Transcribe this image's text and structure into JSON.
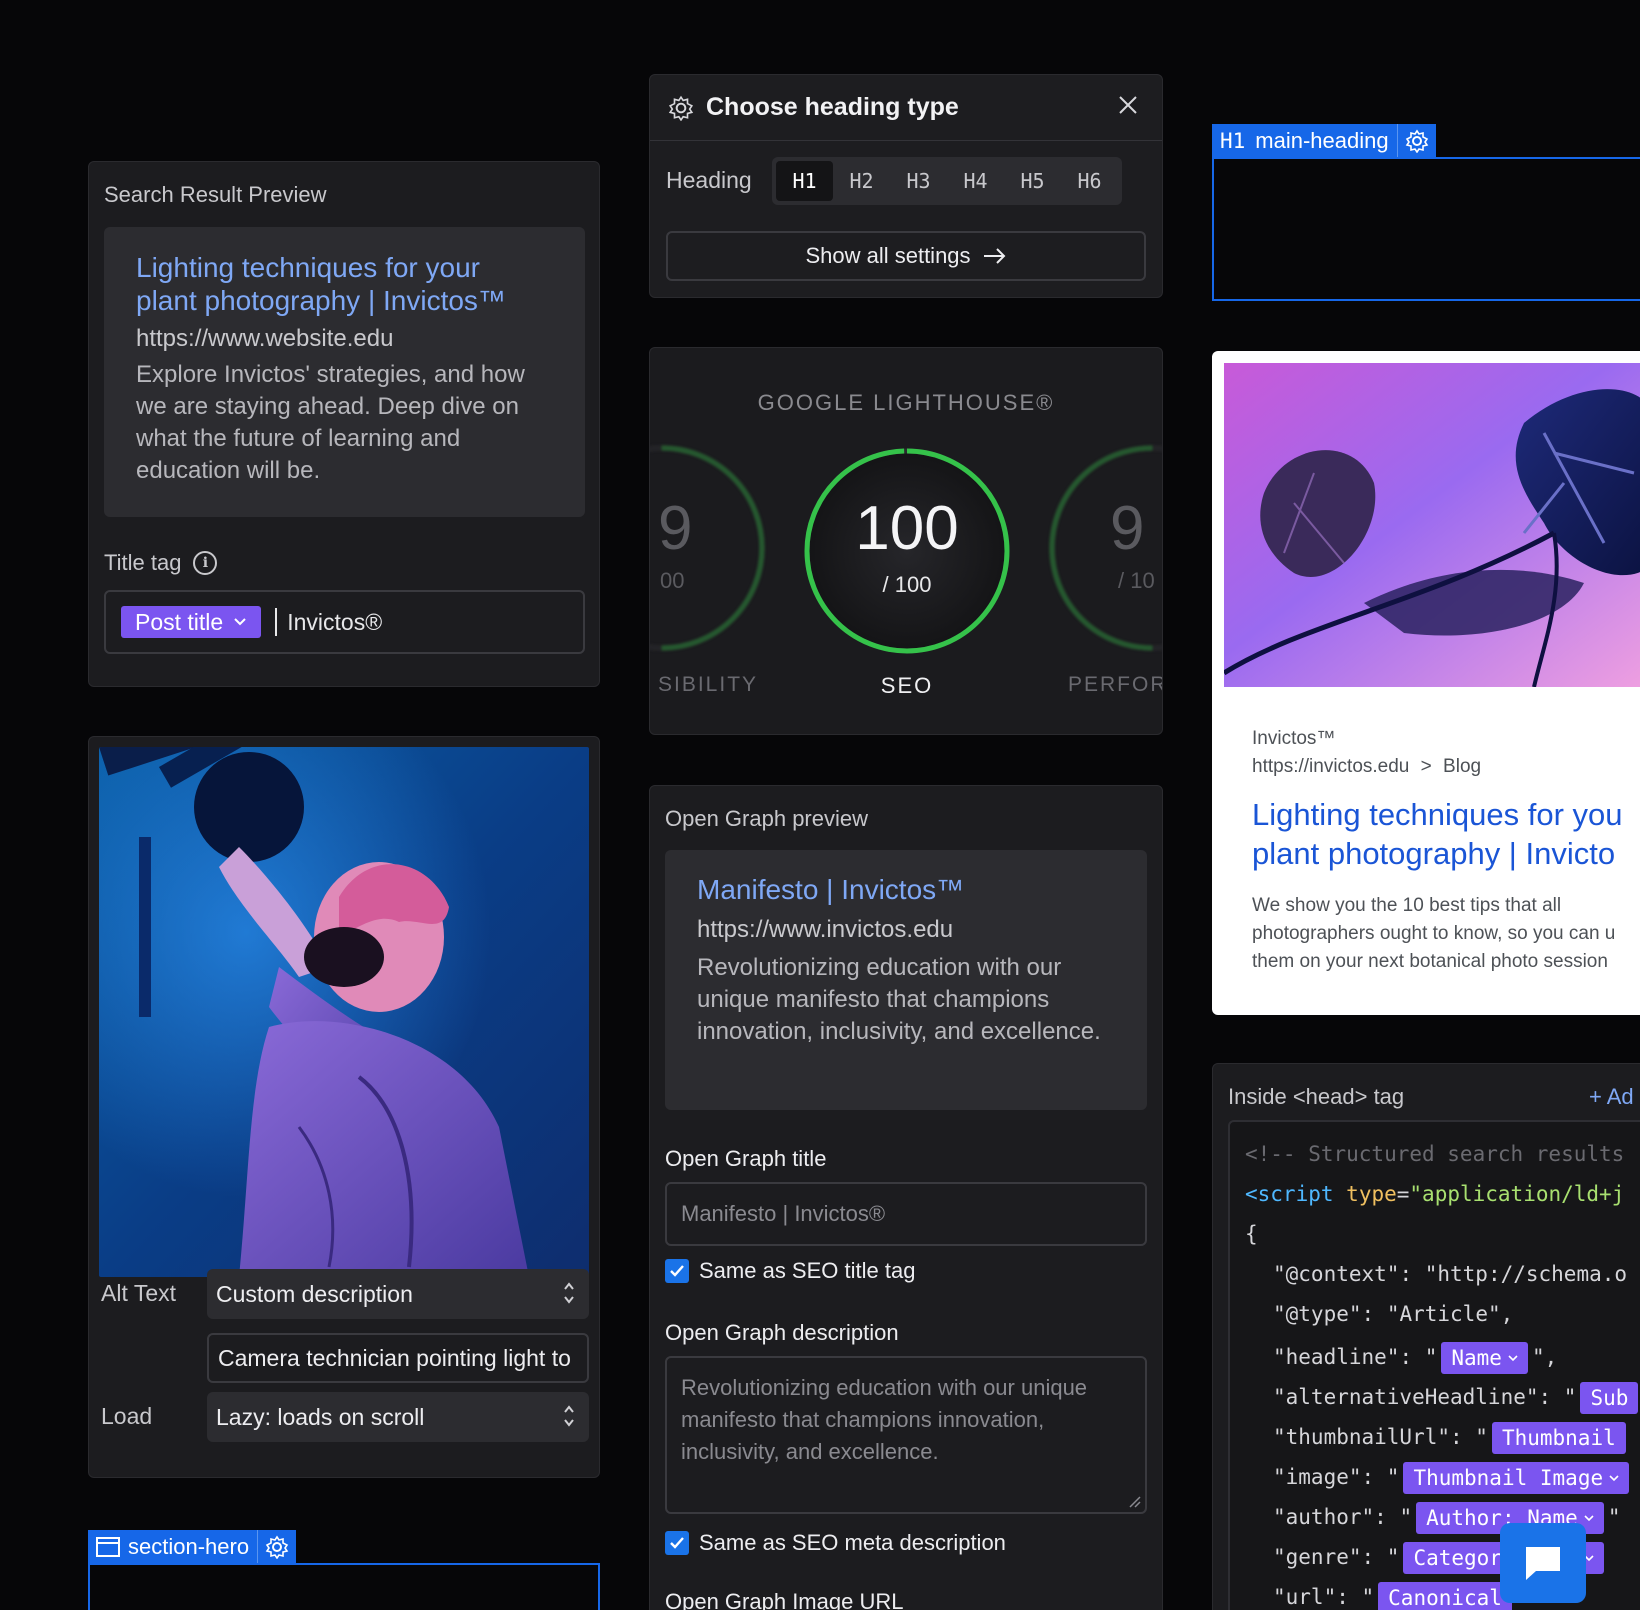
{
  "search_preview": {
    "header": "Search Result Preview",
    "title_line1": "Lighting techniques for your",
    "title_line2": "plant photography | Invictos™",
    "url": "https://www.website.edu",
    "description": "Explore Invictos' strategies, and how we are staying ahead. Deep dive on what the future of learning and education will be.",
    "title_tag_label": "Title tag",
    "title_chip": "Post title",
    "title_suffix": "Invictos®"
  },
  "image_panel": {
    "alt_label": "Alt Text",
    "alt_mode": "Custom description",
    "alt_value": "Camera technician pointing light to",
    "load_label": "Load",
    "load_value": "Lazy: loads on scroll"
  },
  "section_hero": {
    "label": "section-hero"
  },
  "heading_chooser": {
    "title": "Choose heading type",
    "heading_label": "Heading",
    "options": [
      "H1",
      "H2",
      "H3",
      "H4",
      "H5",
      "H6"
    ],
    "selected": "H1",
    "show_all": "Show all settings"
  },
  "lighthouse": {
    "title": "GOOGLE LIGHTHOUSE®",
    "left_digit": "9",
    "left_sub": "00",
    "left_label": "SIBILITY",
    "score": "100",
    "score_max": "/ 100",
    "center_label": "SEO",
    "right_digit": "9",
    "right_sub": "/ 10",
    "right_label": "PERFOR",
    "colors": {
      "ring": "#35c24a",
      "track": "#2a2a2e"
    }
  },
  "open_graph": {
    "header": "Open Graph preview",
    "title": "Manifesto | Invictos™",
    "url": "https://www.invictos.edu",
    "description": "Revolutionizing education with our unique manifesto that champions innovation, inclusivity, and excellence.",
    "og_title_label": "Open Graph title",
    "og_title_placeholder": "Manifesto | Invictos®",
    "same_title": "Same as SEO title tag",
    "og_desc_label": "Open Graph description",
    "og_desc_placeholder": "Revolutionizing education with our unique manifesto that champions innovation, inclusivity, and excellence.",
    "same_desc": "Same as SEO meta description",
    "og_image_label": "Open Graph Image URL"
  },
  "main_heading": {
    "tag": "H1",
    "label": "main-heading"
  },
  "google_preview": {
    "site": "Invictos™",
    "crumb_url": "https://invictos.edu",
    "crumb_sep": ">",
    "crumb_page": "Blog",
    "title_line1": "Lighting techniques for you",
    "title_line2": "plant photography | Invicto",
    "desc_line1": "We show you the 10 best tips that all",
    "desc_line2": "photographers ought to know, so you can u",
    "desc_line3": "them on your next botanical photo session"
  },
  "head_tag": {
    "header": "Inside <head> tag",
    "add": "+ Ad",
    "lines": {
      "comment": "<!-- Structured search results",
      "script_open": "<script",
      "script_attr": "type",
      "script_val": "\"application/ld+j",
      "brace": "{",
      "context_key": "\"@context\"",
      "context_val": "\"http://schema.o",
      "type_key": "\"@type\"",
      "type_val": "\"Article\",",
      "headline_key": "\"headline\"",
      "headline_chip": "Name",
      "alt_key": "\"alternativeHeadline\"",
      "alt_chip": "Sub",
      "thumb_key": "\"thumbnailUrl\"",
      "thumb_chip": "Thumbnail",
      "image_key": "\"image\"",
      "image_chip": "Thumbnail Image",
      "author_key": "\"author\"",
      "author_chip": "Author: Name",
      "genre_key": "\"genre\"",
      "genre_chip": "Category Name",
      "url_key": "\"url\"",
      "url_chip": "Canonical"
    }
  }
}
